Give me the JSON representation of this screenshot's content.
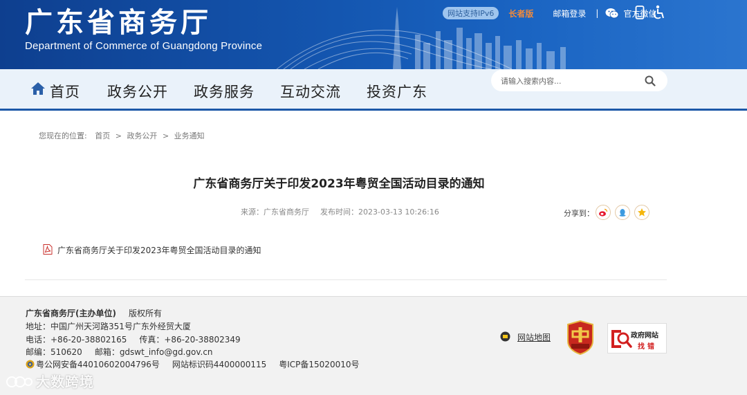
{
  "header": {
    "title": "广东省商务厅",
    "subtitle": "Department of Commerce of Guangdong Province",
    "ipv6_badge": "网站支持IPv6",
    "elderly_mode": "长者版",
    "mail_login": "邮箱登录",
    "divider": "|",
    "wechat": "官方微信"
  },
  "nav": {
    "items": [
      "首页",
      "政务公开",
      "政务服务",
      "互动交流",
      "投资广东"
    ],
    "search_placeholder": "请输入搜索内容..."
  },
  "breadcrumb": {
    "prefix": "您现在的位置:",
    "items": [
      "首页",
      "政务公开",
      "业务通知"
    ],
    "separator": ">"
  },
  "article": {
    "title": "广东省商务厅关于印发2023年粤贸全国活动目录的通知",
    "source": "来源：广东省商务厅",
    "published": "发布时间：2023-03-13 10:26:16",
    "share_label": "分享到：",
    "attachment": "广东省商务厅关于印发2023年粤贸全国活动目录的通知"
  },
  "footer": {
    "organizer": "广东省商务厅(主办单位)",
    "copyright": "版权所有",
    "address": "地址：中国广州天河路351号广东外经贸大厦",
    "phone": "电话：+86-20-38802165",
    "fax": "传真：+86-20-38802349",
    "postcode": "邮编：510620",
    "email": "邮箱：gdswt_info@gd.gov.cn",
    "police_record": "粤公网安备44010602004796号",
    "site_id": "网站标识码4400000115",
    "icp": "粤ICP备15020010号",
    "sitemap": "网站地图",
    "gov_error_line1": "政府网站",
    "gov_error_line2": "找错"
  },
  "watermark": "大数跨境",
  "colors": {
    "banner": "#1456b0",
    "nav_bg": "#eaf2fa",
    "nav_border": "#1c58a8",
    "elderly": "#f08a3c",
    "footer_bg": "#f2f2f2"
  }
}
